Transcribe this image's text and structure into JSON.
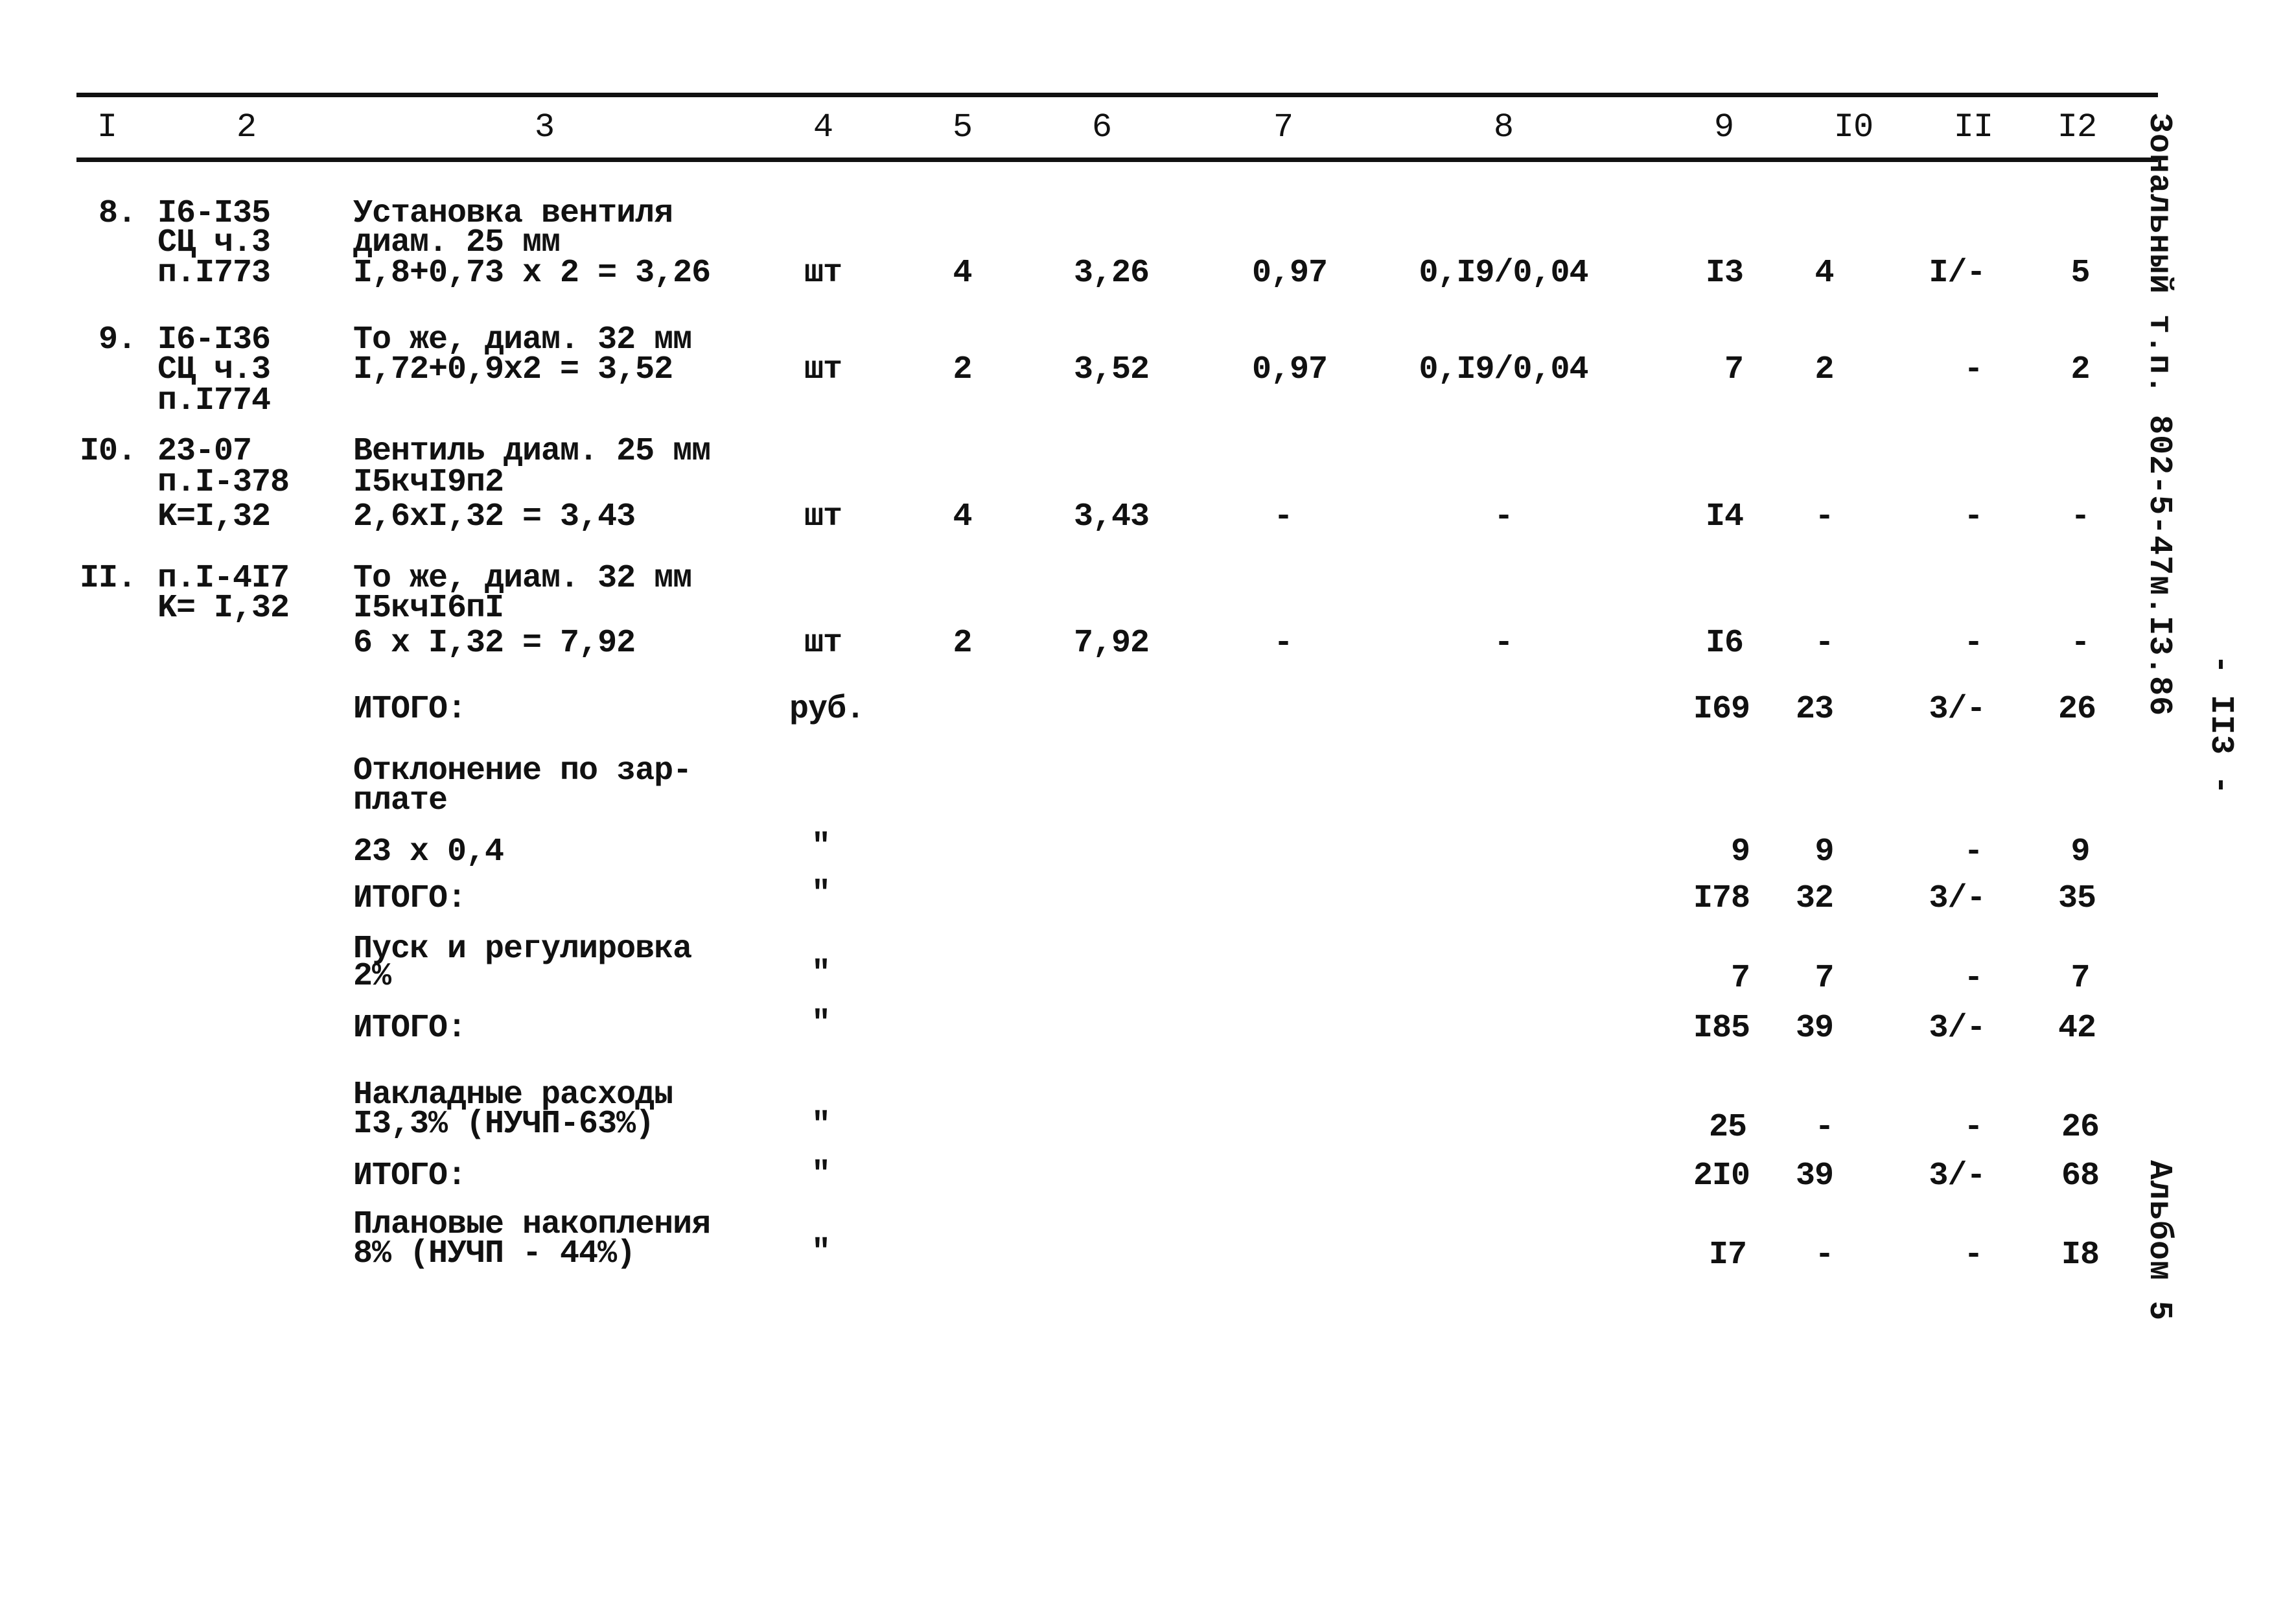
{
  "header": {
    "columns": [
      "I",
      "2",
      "3",
      "4",
      "5",
      "6",
      "7",
      "8",
      "9",
      "I0",
      "II",
      "I2"
    ]
  },
  "rows": [
    {
      "num": "8.",
      "ref": [
        "I6-I35",
        "СЦ ч.3",
        "п.I773"
      ],
      "desc": [
        "Установка вентиля",
        "диам. 25 мм",
        "I,8+0,73 x 2 = 3,26"
      ],
      "unit": "шт",
      "c5": "4",
      "c6": "3,26",
      "c7": "0,97",
      "c8": "0,I9/0,04",
      "c9": "I3",
      "c10": "4",
      "c11": "I/-",
      "c12": "5"
    },
    {
      "num": "9.",
      "ref": [
        "I6-I36",
        "СЦ ч.3",
        "п.I774"
      ],
      "desc": [
        "То же, диам. 32 мм",
        "I,72+0,9x2 = 3,52"
      ],
      "unit": "шт",
      "c5": "2",
      "c6": "3,52",
      "c7": "0,97",
      "c8": "0,I9/0,04",
      "c9": "7",
      "c10": "2",
      "c11": "-",
      "c12": "2"
    },
    {
      "num": "I0.",
      "ref": [
        "23-07",
        "п.I-378",
        "K=I,32"
      ],
      "desc": [
        "Вентиль диам. 25 мм",
        "I5кчI9п2",
        "2,6xI,32 = 3,43"
      ],
      "unit": "шт",
      "c5": "4",
      "c6": "3,43",
      "c7": "-",
      "c8": "-",
      "c9": "I4",
      "c10": "-",
      "c11": "-",
      "c12": "-"
    },
    {
      "num": "II.",
      "ref": [
        "п.I-4I7",
        "K= I,32"
      ],
      "desc": [
        "То же, диам. 32 мм",
        "I5кчI6пI",
        "6 x I,32 = 7,92"
      ],
      "unit": "шт",
      "c5": "2",
      "c6": "7,92",
      "c7": "-",
      "c8": "-",
      "c9": "I6",
      "c10": "-",
      "c11": "-",
      "c12": "-"
    }
  ],
  "summary": [
    {
      "desc": [
        "ИТОГО:"
      ],
      "unit": "руб.",
      "c9": "I69",
      "c10": "23",
      "c11": "3/-",
      "c12": "26"
    },
    {
      "desc": [
        "Отклонение по зар-",
        "плате"
      ],
      "unit": "",
      "c9": "",
      "c10": "",
      "c11": "",
      "c12": ""
    },
    {
      "desc": [
        "23 x 0,4"
      ],
      "unit": "\"",
      "c9": "9",
      "c10": "9",
      "c11": "-",
      "c12": "9"
    },
    {
      "desc": [
        "ИТОГО:"
      ],
      "unit": "\"",
      "c9": "I78",
      "c10": "32",
      "c11": "3/-",
      "c12": "35"
    },
    {
      "desc": [
        "Пуск и регулировка",
        "2%"
      ],
      "unit": "\"",
      "c9": "7",
      "c10": "7",
      "c11": "-",
      "c12": "7"
    },
    {
      "desc": [
        "ИТОГО:"
      ],
      "unit": "\"",
      "c9": "I85",
      "c10": "39",
      "c11": "3/-",
      "c12": "42"
    },
    {
      "desc": [
        "Накладные расходы",
        "I3,3% (НУЧП-63%)"
      ],
      "unit": "\"",
      "c9": "25",
      "c10": "-",
      "c11": "-",
      "c12": "26"
    },
    {
      "desc": [
        "ИТОГО:"
      ],
      "unit": "\"",
      "c9": "2I0",
      "c10": "39",
      "c11": "3/-",
      "c12": "68"
    },
    {
      "desc": [
        "Плановые накопления",
        "8% (НУЧП - 44%)"
      ],
      "unit": "\"",
      "c9": "I7",
      "c10": "-",
      "c11": "-",
      "c12": "I8"
    }
  ],
  "side": {
    "project": "Зональный т.п. 802-5-47м.I3.86",
    "page_number": "- II3 -",
    "album": "Альбом 5"
  }
}
